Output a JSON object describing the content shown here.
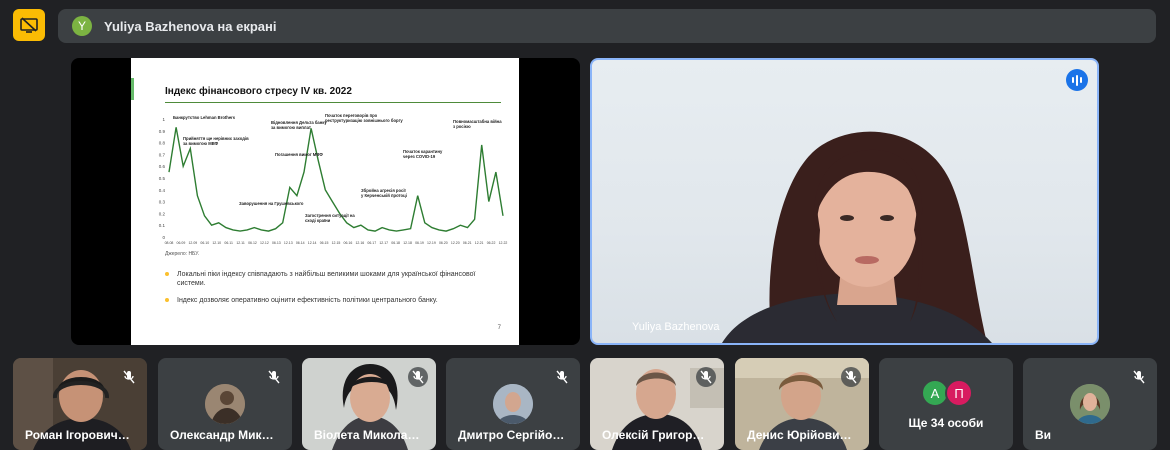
{
  "top_bar": {
    "presenter_name": "Yuliya Bazhenova",
    "presenting_text": "Yuliya Bazhenova на екрані",
    "avatar_letter": "Y",
    "present_icon": "stop-presenting-icon"
  },
  "slide": {
    "title": "Індекс фінансового стресу IV кв. 2022",
    "source": "Джерело: НБУ.",
    "bullets": [
      "Локальні піки індексу співпадають з найбільш великими шоками для української фінансової системи.",
      "Індекс дозволяє оперативно оцінити ефективність політики центрального банку."
    ],
    "page_number": "7"
  },
  "chart_data": {
    "type": "line",
    "title": "Індекс фінансового стресу IV кв. 2022",
    "ylim": [
      0,
      1
    ],
    "y_ticks": [
      "1",
      "0.9",
      "0.8",
      "0.7",
      "0.6",
      "0.5",
      "0.4",
      "0.3",
      "0.2",
      "0.1",
      "0"
    ],
    "x_ticks": [
      "08.08",
      "06.09",
      "12.09",
      "06.10",
      "12.10",
      "06.11",
      "12.11",
      "06.12",
      "12.12",
      "06.13",
      "12.13",
      "06.14",
      "12.14",
      "06.15",
      "12.15",
      "06.16",
      "12.16",
      "06.17",
      "12.17",
      "06.18",
      "12.18",
      "06.19",
      "12.19",
      "06.20",
      "12.20",
      "06.21",
      "12.21",
      "06.22",
      "12.22"
    ],
    "series": [
      {
        "values": [
          0.55,
          0.93,
          0.6,
          0.75,
          0.35,
          0.18,
          0.1,
          0.12,
          0.08,
          0.06,
          0.05,
          0.06,
          0.08,
          0.06,
          0.05,
          0.07,
          0.12,
          0.42,
          0.35,
          0.55,
          0.92,
          0.65,
          0.4,
          0.3,
          0.2,
          0.12,
          0.08,
          0.1,
          0.06,
          0.05,
          0.08,
          0.06,
          0.05,
          0.06,
          0.07,
          0.35,
          0.12,
          0.08,
          0.06,
          0.05,
          0.07,
          0.1,
          0.08,
          0.15,
          0.78,
          0.3,
          0.55,
          0.18
        ]
      }
    ],
    "annotations": [
      "Банкрутство Lehman Brothers",
      "Прийняття ще нерівних заходів за вимогою МВФ",
      "Відновлення Дельта банку за вимогою виплат",
      "Початок переговорів про реструктуризацію зовнішнього боргу",
      "Повномасштабна війна з росією",
      "Погашення вимог МВФ",
      "Початок карантину через COVID-19",
      "Заворушення на Грушевського",
      "Збройна агресія росії у Керченській протоці",
      "Загострення ситуації на сході країни"
    ]
  },
  "speaker": {
    "name": "Yuliya Bazhenova"
  },
  "participants": [
    {
      "name": "Роман Ігорович…",
      "muted": true
    },
    {
      "name": "Олександр Мик…",
      "muted": true
    },
    {
      "name": "Віолета Микола…",
      "muted": true
    },
    {
      "name": "Дмитро Сергійо…",
      "muted": true
    },
    {
      "name": "Олексій Григор…",
      "muted": true
    },
    {
      "name": "Денис Юрійови…",
      "muted": true
    },
    {
      "more_label": "Ще 34 особи",
      "avatar_letters": [
        "А",
        "П"
      ]
    },
    {
      "name": "Ви",
      "muted": true
    }
  ],
  "colors": {
    "accent": "#fbbc04",
    "speaking": "#1a73e8",
    "chart_line": "#2e7d32",
    "avatar_a": "#34a853",
    "avatar_p": "#d81b60"
  }
}
